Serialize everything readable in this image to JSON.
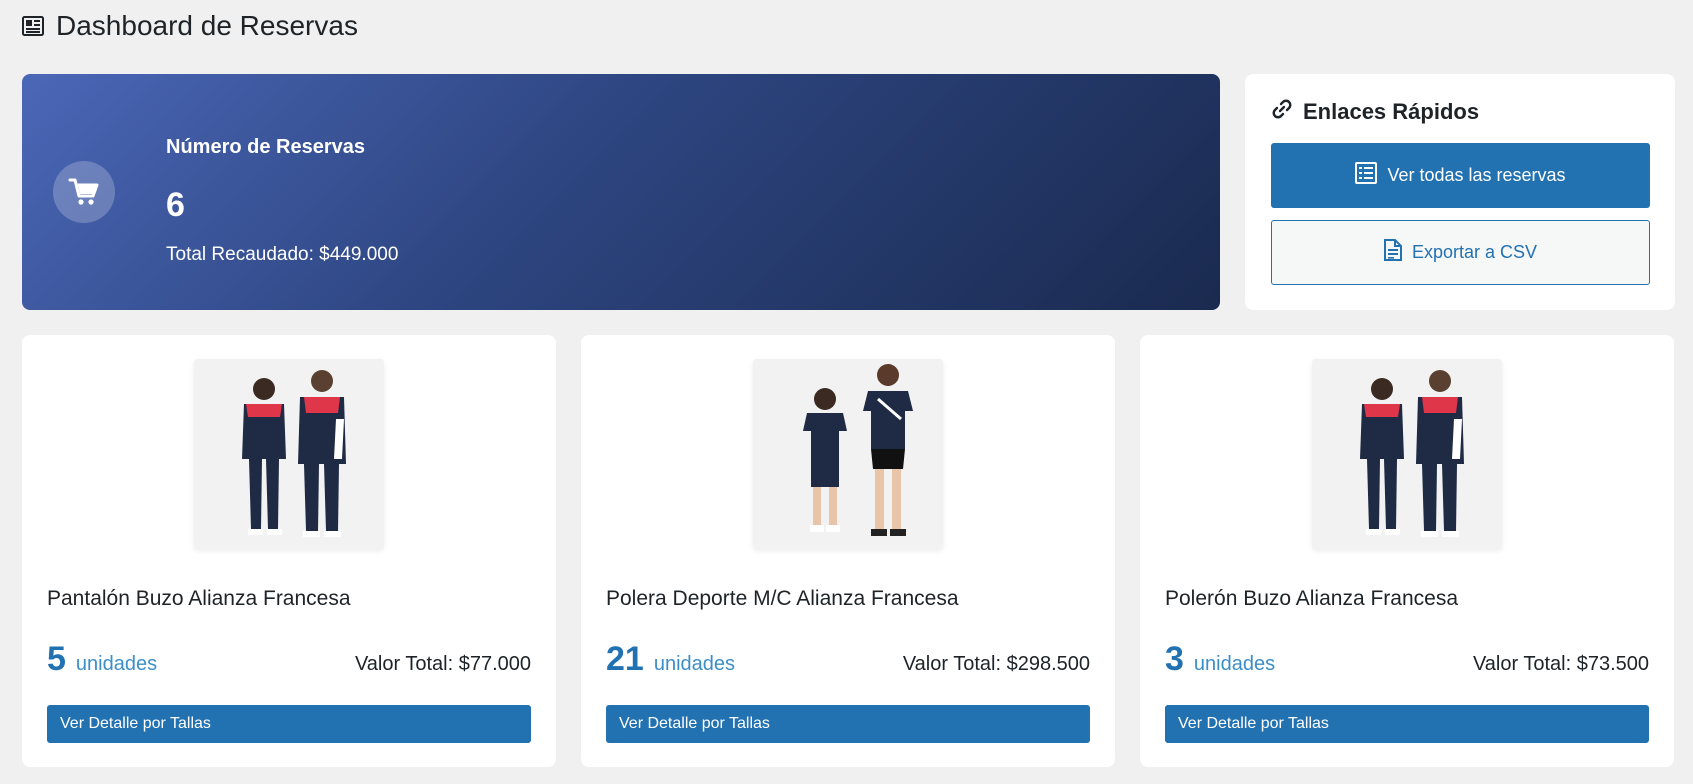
{
  "header": {
    "title": "Dashboard de Reservas",
    "icon": "dashboard-icon"
  },
  "summary": {
    "label": "Número de Reservas",
    "count": "6",
    "total": "Total Recaudado: $449.000",
    "icon": "cart-icon"
  },
  "quick_links": {
    "title": "Enlaces Rápidos",
    "view_all_label": "Ver todas las reservas",
    "export_label": "Exportar a CSV"
  },
  "products": [
    {
      "name": "Pantalón Buzo Alianza Francesa",
      "quantity": "5",
      "unit": "unidades",
      "total": "Valor Total: $77.000",
      "button": "Ver Detalle por Tallas"
    },
    {
      "name": "Polera Deporte M/C Alianza Francesa",
      "quantity": "21",
      "unit": "unidades",
      "total": "Valor Total: $298.500",
      "button": "Ver Detalle por Tallas"
    },
    {
      "name": "Polerón Buzo Alianza Francesa",
      "quantity": "3",
      "unit": "unidades",
      "total": "Valor Total: $73.500",
      "button": "Ver Detalle por Tallas"
    }
  ],
  "colors": {
    "accent": "#2271b1",
    "gradient_start": "#4b67b7",
    "gradient_end": "#1a2a4f",
    "background": "#f0f0f1"
  }
}
